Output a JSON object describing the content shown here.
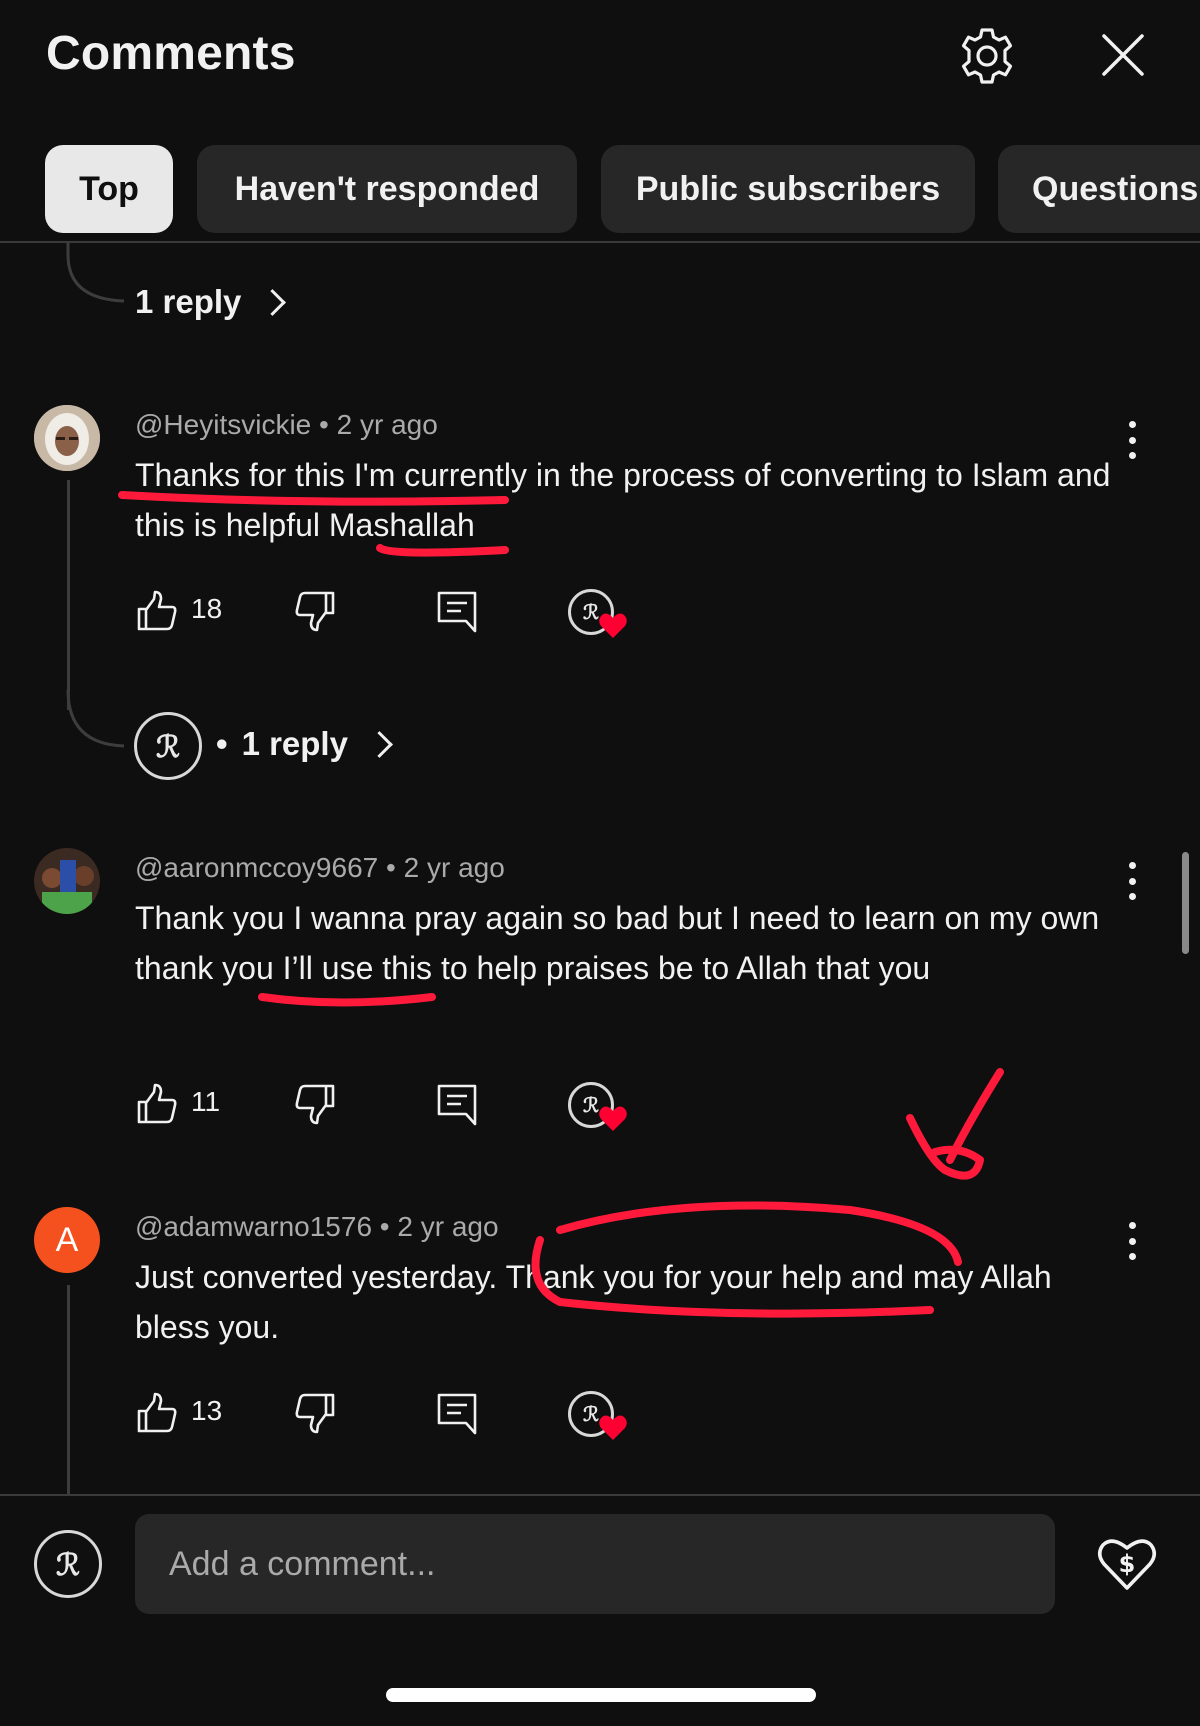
{
  "header": {
    "title": "Comments"
  },
  "filters": {
    "chips": [
      {
        "label": "Top",
        "active": true
      },
      {
        "label": "Haven't responded",
        "active": false
      },
      {
        "label": "Public subscribers",
        "active": false
      },
      {
        "label": "Questions",
        "active": false
      }
    ]
  },
  "thread_top": {
    "reply_label": "1 reply"
  },
  "comments": [
    {
      "handle": "@Heyitsvickie",
      "time": "2 yr ago",
      "text": "Thanks for this I'm currently in the process of converting to Islam and this is helpful Mashallah",
      "likes": "18",
      "reply_label": "1 reply",
      "avatar_icon": "user-photo"
    },
    {
      "handle": "@aaronmccoy9667",
      "time": "2 yr ago",
      "text": "Thank you I wanna pray again so bad but I need to learn on my own thank you I’ll use this to help praises be to Allah that you",
      "likes": "11",
      "avatar_icon": "user-photo"
    },
    {
      "handle": "@adamwarno1576",
      "time": "2 yr ago",
      "text": "Just converted yesterday. Thank you for your help and may Allah bless you.",
      "likes": "13",
      "avatar_letter": "A"
    }
  ],
  "composer": {
    "placeholder": "Add a comment..."
  },
  "colors": {
    "background": "#0f0f0f",
    "chip": "#272727",
    "chip_active": "#e8e8e8",
    "meta_text": "#aaaaaa",
    "heart": "#ff0033",
    "markup_red": "#ff1a3c",
    "avatar_orange": "#f4511e"
  },
  "icons": [
    "settings-gear-icon",
    "close-x-icon",
    "thumbs-up-icon",
    "thumbs-down-icon",
    "reply-comment-icon",
    "creator-heart-icon",
    "more-vert-icon",
    "super-thanks-heart-dollar-icon"
  ]
}
